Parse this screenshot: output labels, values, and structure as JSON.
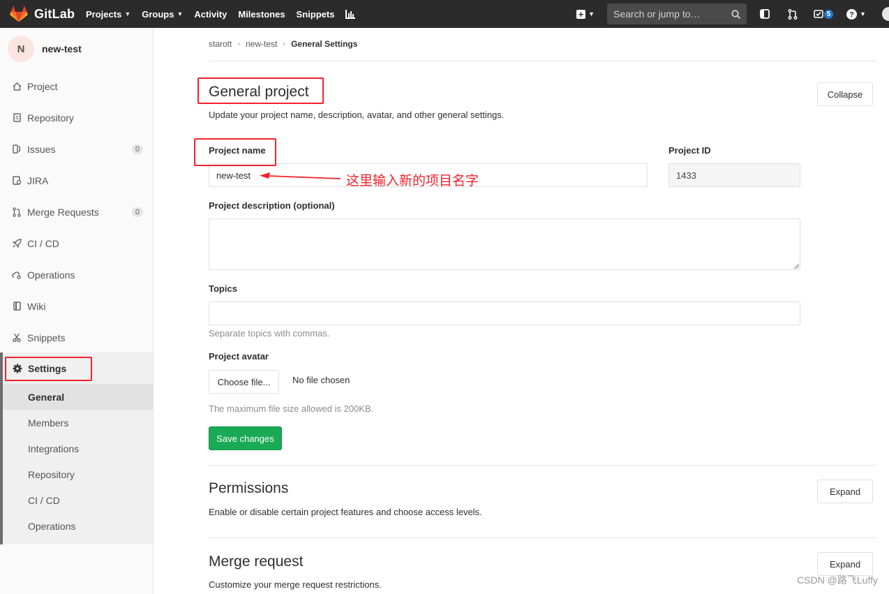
{
  "colors": {
    "navbar": "#2b2b2b",
    "accent": "#1aaa55",
    "annotation": "#f1222c",
    "badge": "#1f78d1"
  },
  "navbar": {
    "brand": "GitLab",
    "links": [
      {
        "label": "Projects",
        "dropdown": true
      },
      {
        "label": "Groups",
        "dropdown": true
      },
      {
        "label": "Activity",
        "dropdown": false
      },
      {
        "label": "Milestones",
        "dropdown": false
      },
      {
        "label": "Snippets",
        "dropdown": false
      }
    ],
    "search_placeholder": "Search or jump to…",
    "todo_count": "5",
    "icons": [
      "plus-square-icon",
      "search-icon",
      "sidebar-toggle-icon",
      "merge-request-icon",
      "todo-check-icon",
      "help-icon",
      "chart-icon"
    ]
  },
  "sidebar": {
    "project_initial": "N",
    "project_name": "new-test",
    "items": [
      {
        "label": "Project",
        "icon": "home-icon"
      },
      {
        "label": "Repository",
        "icon": "doc-icon"
      },
      {
        "label": "Issues",
        "icon": "issues-icon",
        "count": "0"
      },
      {
        "label": "JIRA",
        "icon": "jira-icon"
      },
      {
        "label": "Merge Requests",
        "icon": "merge-request-icon",
        "count": "0"
      },
      {
        "label": "CI / CD",
        "icon": "rocket-icon"
      },
      {
        "label": "Operations",
        "icon": "cloud-gear-icon"
      },
      {
        "label": "Wiki",
        "icon": "book-icon"
      },
      {
        "label": "Snippets",
        "icon": "scissors-icon"
      }
    ],
    "settings": {
      "label": "Settings",
      "sub_items": [
        "General",
        "Members",
        "Integrations",
        "Repository",
        "CI / CD",
        "Operations"
      ]
    }
  },
  "breadcrumb": {
    "items": [
      "starott",
      "new-test",
      "General Settings"
    ]
  },
  "general": {
    "title": "General project",
    "description": "Update your project name, description, avatar, and other general settings.",
    "collapse_label": "Collapse",
    "name_label": "Project name",
    "name_value": "new-test",
    "id_label": "Project ID",
    "id_value": "1433",
    "desc_label": "Project description (optional)",
    "topics_label": "Topics",
    "topics_hint": "Separate topics with commas.",
    "avatar_label": "Project avatar",
    "choose_file": "Choose file...",
    "no_file": "No file chosen",
    "max_size": "The maximum file size allowed is 200KB.",
    "save_label": "Save changes"
  },
  "permissions": {
    "title": "Permissions",
    "description": "Enable or disable certain project features and choose access levels.",
    "expand_label": "Expand"
  },
  "merge_request": {
    "title": "Merge request",
    "description": "Customize your merge request restrictions.",
    "expand_label": "Expand"
  },
  "annotation": "这里输入新的项目名字",
  "watermark": "CSDN @路飞Luffy"
}
